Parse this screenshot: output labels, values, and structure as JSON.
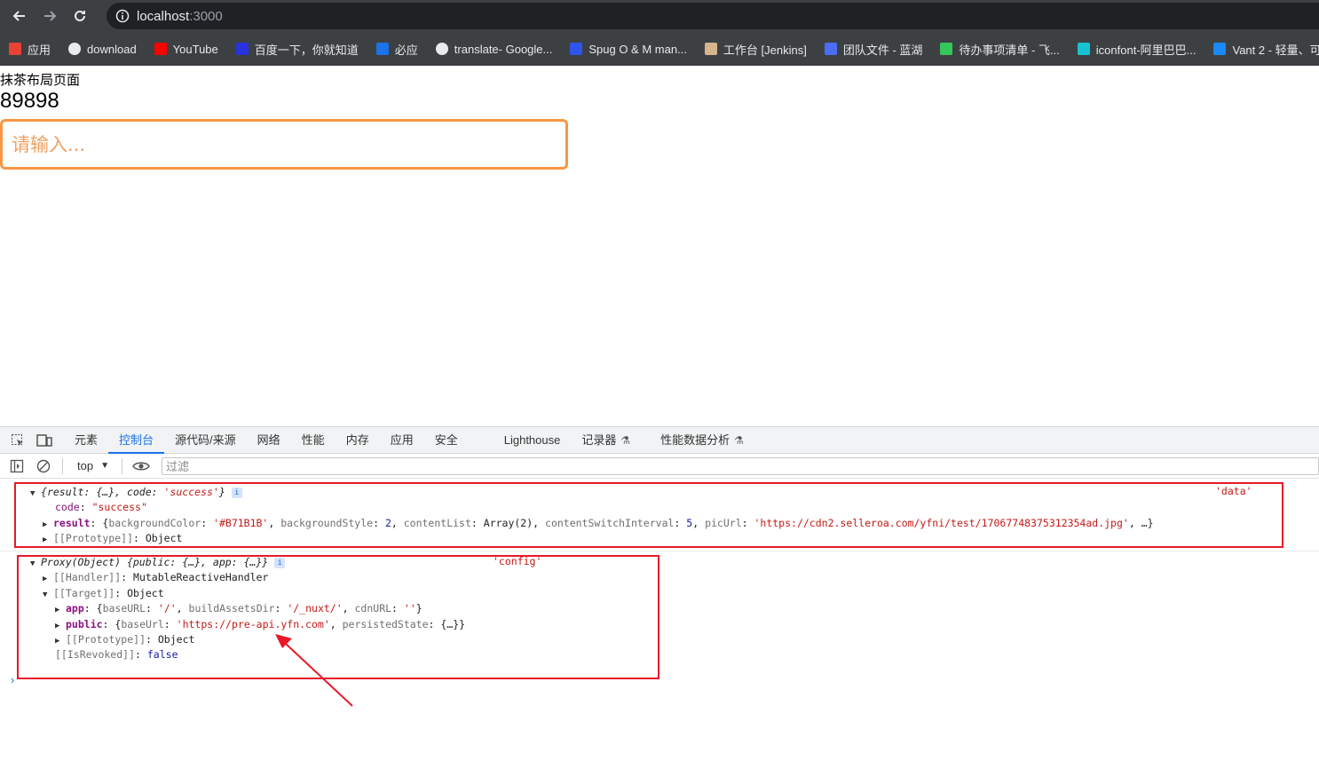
{
  "browser": {
    "url_host": "localhost",
    "url_port": ":3000",
    "bookmarks": [
      {
        "label": "应用",
        "icon": "apps-grid-icon",
        "color": "#e94235"
      },
      {
        "label": "download",
        "icon": "globe-icon",
        "color": "#e8eaed"
      },
      {
        "label": "YouTube",
        "icon": "youtube-icon",
        "color": "#ff0000"
      },
      {
        "label": "百度一下，你就知道",
        "icon": "baidu-paw-icon",
        "color": "#2932e1"
      },
      {
        "label": "必应",
        "icon": "bing-search-icon",
        "color": "#1a73e8"
      },
      {
        "label": "translate- Google...",
        "icon": "google-g-icon",
        "color": "#e8eaed"
      },
      {
        "label": "Spug O & M man...",
        "icon": "spug-icon",
        "color": "#2f54eb"
      },
      {
        "label": "工作台 [Jenkins]",
        "icon": "jenkins-icon",
        "color": "#d8b48c"
      },
      {
        "label": "团队文件 - 蓝湖",
        "icon": "lanhu-icon",
        "color": "#4c6ef5"
      },
      {
        "label": "待办事项清单 - 飞...",
        "icon": "feishu-sheet-icon",
        "color": "#34c759"
      },
      {
        "label": "iconfont-阿里巴巴...",
        "icon": "iconfont-icon",
        "color": "#19c2d2"
      },
      {
        "label": "Vant 2 - 轻量、可...",
        "icon": "vant-icon",
        "color": "#1989fa"
      }
    ]
  },
  "page": {
    "title": "抹茶布局页面",
    "number": "89898",
    "input_placeholder": "请输入..."
  },
  "devtools": {
    "tabs": [
      "元素",
      "控制台",
      "源代码/来源",
      "网络",
      "性能",
      "内存",
      "应用",
      "安全",
      "Lighthouse",
      "记录器",
      "性能数据分析"
    ],
    "active_tab": "控制台",
    "context": "top",
    "filter_placeholder": "过滤",
    "log1": {
      "source": "'data'",
      "summary_result": "result",
      "summary_mid": ": {…}, ",
      "summary_code": "code",
      "summary_code_sep": ": ",
      "summary_code_val": "'success'",
      "code_key": "code",
      "code_val": "\"success\"",
      "result_key": "result",
      "bg_key": "backgroundColor",
      "bg_val": "'#B71B1B'",
      "style_key": "backgroundStyle",
      "style_val": "2",
      "list_key": "contentList",
      "list_val": "Array(2)",
      "interval_key": "contentSwitchInterval",
      "interval_val": "5",
      "pic_key": "picUrl",
      "pic_val": "'https://cdn2.selleroa.com/yfni/test/17067748375312354ad.jpg'",
      "tail": ", …}",
      "proto_key": "[[Prototype]]",
      "proto_val": "Object"
    },
    "log2": {
      "source": "'config'",
      "summary": "Proxy(Object)",
      "summary_public": "public",
      "summary_app": "app",
      "handler_key": "[[Handler]]",
      "handler_val": "MutableReactiveHandler",
      "target_key": "[[Target]]",
      "target_val": "Object",
      "app_key": "app",
      "baseurl_key": "baseURL",
      "baseurl_val": "'/'",
      "assets_key": "buildAssetsDir",
      "assets_val": "'/_nuxt/'",
      "cdn_key": "cdnURL",
      "cdn_val": "''",
      "public_key": "public",
      "baseUrl_key": "baseUrl",
      "baseUrl_val": "'https://pre-api.yfn.com'",
      "persist_key": "persistedState",
      "persist_val": "{…}}",
      "proto_key": "[[Prototype]]",
      "proto_val": "Object",
      "revoked_key": "[[IsRevoked]]",
      "revoked_val": "false"
    }
  },
  "annotation_color": "#e8182a"
}
